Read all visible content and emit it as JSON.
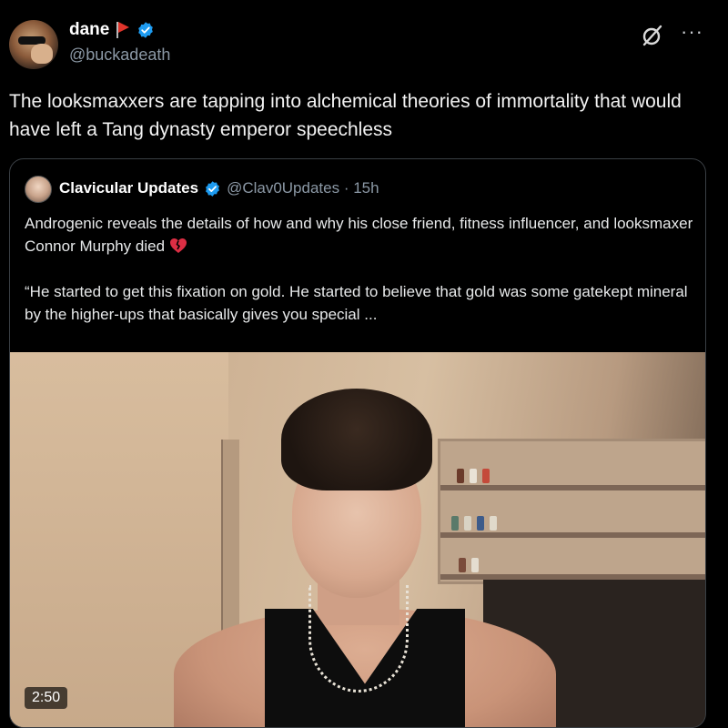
{
  "post": {
    "display_name": "dane",
    "handle": "@buckadeath",
    "text": "The looksmaxxers are tapping into alchemical theories of immortality that would have left a Tang dynasty emperor speechless"
  },
  "quote": {
    "display_name": "Clavicular Updates",
    "handle_time": "@Clav0Updates · 15h",
    "paragraph1": "Androgenic reveals the details of how and why his close friend, fitness influencer, and looksmaxer Connor Murphy died",
    "paragraph2": "“He started to get this fixation on gold. He started to believe that gold was some gatekept mineral by the higher-ups that basically gives you special ...",
    "video_duration": "2:50"
  },
  "icons": {
    "flag": "red-flag-icon",
    "verified": "verified-badge-icon",
    "grok": "grok-icon",
    "more": "more-icon",
    "broken_heart": "broken-heart-icon"
  },
  "colors": {
    "background": "#000000",
    "verified_blue": "#1d9bf0",
    "muted_text": "#8b98a5",
    "flag_red": "#e0342b"
  }
}
